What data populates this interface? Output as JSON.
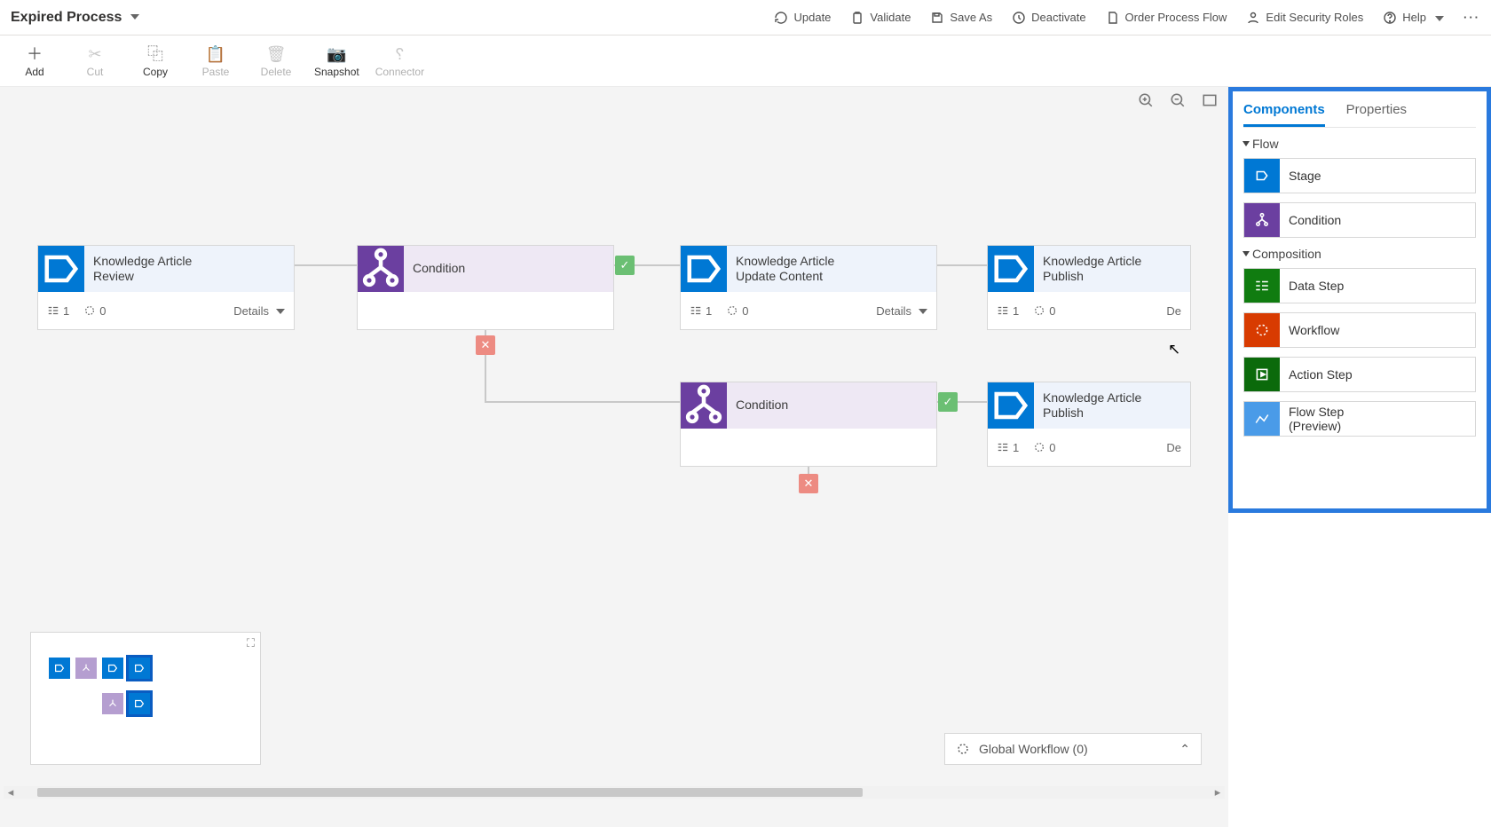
{
  "header": {
    "title": "Expired Process",
    "actions": {
      "update": "Update",
      "validate": "Validate",
      "saveas": "Save As",
      "deactivate": "Deactivate",
      "order": "Order Process Flow",
      "security": "Edit Security Roles",
      "help": "Help"
    }
  },
  "toolbar": {
    "add": "Add",
    "cut": "Cut",
    "copy": "Copy",
    "paste": "Paste",
    "delete": "Delete",
    "snapshot": "Snapshot",
    "connector": "Connector"
  },
  "canvas": {
    "nodes": {
      "n1": {
        "title1": "Knowledge Article",
        "title2": "Review",
        "steps": "1",
        "wf": "0",
        "details": "Details"
      },
      "n2": {
        "title1": "Condition"
      },
      "n3": {
        "title1": "Knowledge Article",
        "title2": "Update Content",
        "steps": "1",
        "wf": "0",
        "details": "Details"
      },
      "n4": {
        "title1": "Knowledge Article",
        "title2": "Publish",
        "steps": "1",
        "wf": "0",
        "details": "De"
      },
      "n5": {
        "title1": "Condition"
      },
      "n6": {
        "title1": "Knowledge Article",
        "title2": "Publish",
        "steps": "1",
        "wf": "0",
        "details": "De"
      }
    },
    "gw": "Global Workflow (0)"
  },
  "panel": {
    "tabs": {
      "components": "Components",
      "properties": "Properties"
    },
    "sections": {
      "flow": "Flow",
      "composition": "Composition"
    },
    "items": {
      "stage": "Stage",
      "condition": "Condition",
      "datastep": "Data Step",
      "workflow": "Workflow",
      "actionstep": "Action Step",
      "flowstep1": "Flow Step",
      "flowstep2": "(Preview)"
    }
  }
}
